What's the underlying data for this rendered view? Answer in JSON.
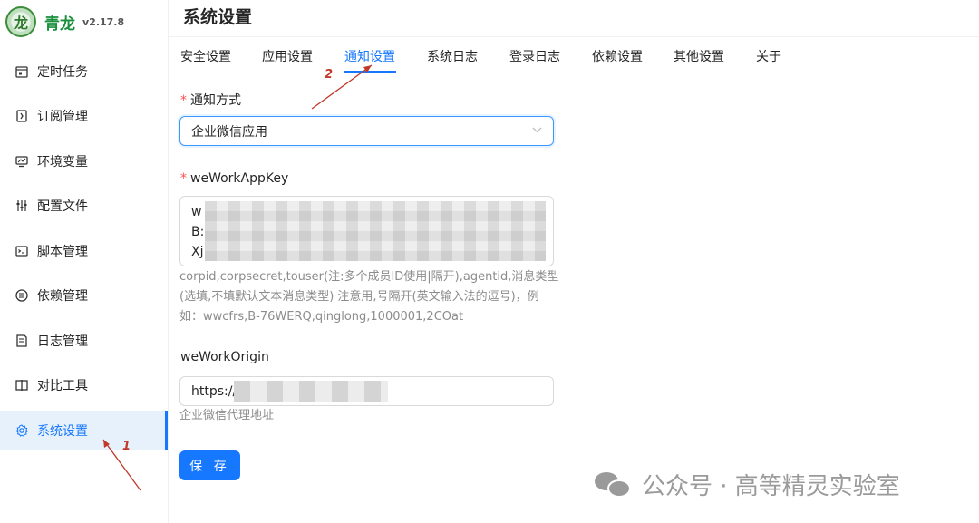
{
  "app": {
    "name": "青龙",
    "version": "v2.17.8",
    "logo_text": "龙"
  },
  "sidebar": {
    "items": [
      {
        "label": "定时任务",
        "icon": "calendar-icon"
      },
      {
        "label": "订阅管理",
        "icon": "subscribe-icon"
      },
      {
        "label": "环境变量",
        "icon": "monitor-icon"
      },
      {
        "label": "配置文件",
        "icon": "sliders-icon"
      },
      {
        "label": "脚本管理",
        "icon": "script-icon"
      },
      {
        "label": "依赖管理",
        "icon": "dependency-icon"
      },
      {
        "label": "日志管理",
        "icon": "log-icon"
      },
      {
        "label": "对比工具",
        "icon": "diff-icon"
      },
      {
        "label": "系统设置",
        "icon": "gear-icon",
        "active": true
      }
    ]
  },
  "header": {
    "title": "系统设置"
  },
  "tabs": [
    "安全设置",
    "应用设置",
    "通知设置",
    "系统日志",
    "登录日志",
    "依赖设置",
    "其他设置",
    "关于"
  ],
  "active_tab": "通知设置",
  "form": {
    "notify_method": {
      "required_mark": "*",
      "label": "通知方式",
      "value": "企业微信应用"
    },
    "app_key": {
      "required_mark": "*",
      "label": "weWorkAppKey",
      "visible_lines": [
        "w",
        "B:",
        "Xj"
      ],
      "help": "corpid,corpsecret,touser(注:多个成员ID使用|隔开),agentid,消息类型(选填,不填默认文本消息类型) 注意用,号隔开(英文输入法的逗号)，例如：wwcfrs,B-76WERQ,qinglong,1000001,2COat"
    },
    "origin": {
      "label": "weWorkOrigin",
      "value": "https://",
      "help": "企业微信代理地址"
    },
    "save_label": "保 存"
  },
  "annotations": {
    "marker_1": "1",
    "marker_2": "2"
  },
  "watermark": {
    "text": "公众号 · 高等精灵实验室"
  },
  "colors": {
    "primary": "#1677ff",
    "active_bg": "#e6f1fb",
    "required": "#ff4d4f",
    "annotation": "#c0392b",
    "brand": "#1a8f3c"
  }
}
